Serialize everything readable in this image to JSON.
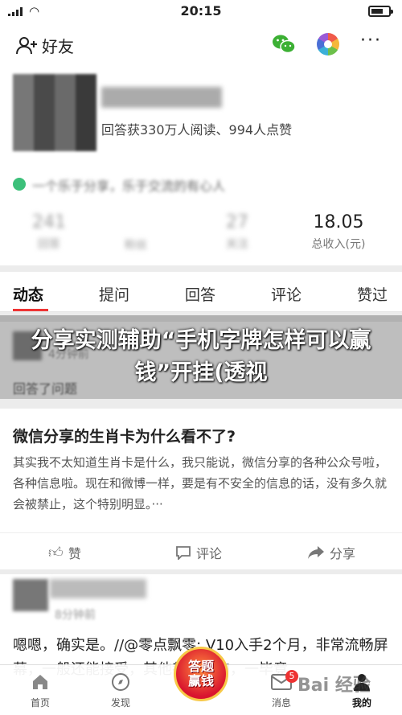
{
  "status": {
    "time": "20:15"
  },
  "topbar": {
    "friends_label": "好友"
  },
  "profile": {
    "stat_line": "回答获330万人阅读、994人点赞",
    "metrics": [
      {
        "num": "241",
        "label": "回答"
      },
      {
        "num": "",
        "label": "粉丝"
      },
      {
        "num": "27",
        "label": "关注"
      },
      {
        "num": "18.05",
        "label": "总收入(元)"
      }
    ]
  },
  "tabs": [
    "动态",
    "提问",
    "回答",
    "评论",
    "赞过"
  ],
  "banner": {
    "text": "分享实测辅助“手机字牌怎样可以赢钱”开挂(透视"
  },
  "post": {
    "title": "微信分享的生肖卡为什么看不了?",
    "body": "其实我不太知道生肖卡是什么，我只能说，微信分享的各种公众号啦，各种信息啦。现在和微博一样，要是有不安全的信息的话，没有多久就会被禁止，这个特别明显。···",
    "like": "赞",
    "comment": "评论",
    "share": "分享"
  },
  "post2": {
    "meta": "8分钟前",
    "text": "嗯嗯，确实是。//@零点飘零: V10入手2个月，非常流畅屏幕，一般还能接受，其他都挺好的，一毕竟"
  },
  "card1": {
    "action": "回答了问题"
  },
  "nav": [
    {
      "label": "首页"
    },
    {
      "label": "发现"
    },
    {
      "label": "消息",
      "badge": "5"
    },
    {
      "label": "我的"
    }
  ],
  "center_button": {
    "line1": "答题",
    "line2": "赢钱"
  },
  "watermark": "Bai 经验"
}
